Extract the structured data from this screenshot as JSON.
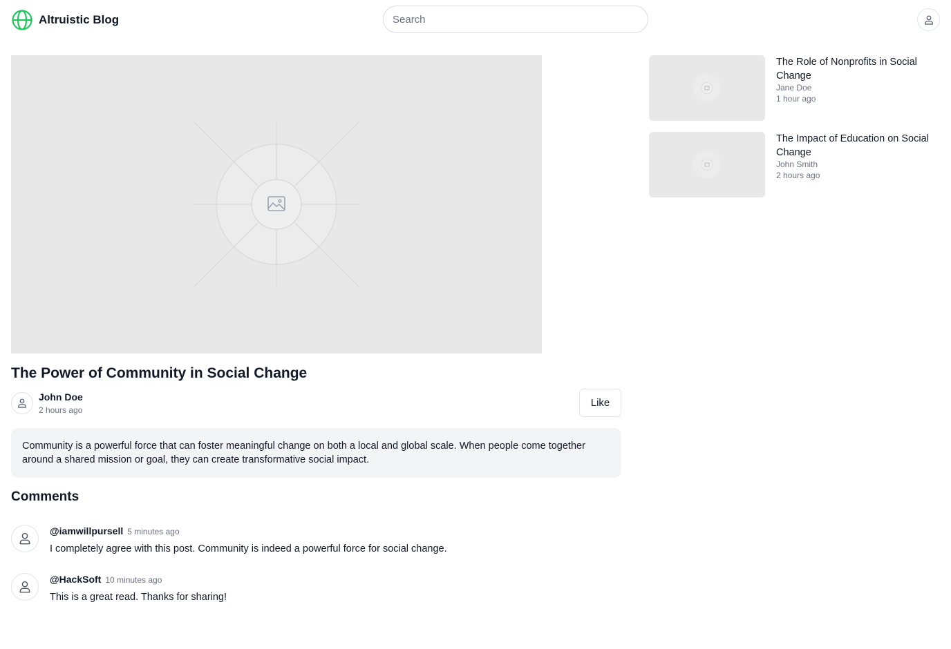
{
  "app": {
    "title": "Altruistic Blog",
    "brand_color": "#16a34a"
  },
  "header": {
    "search_placeholder": "Search",
    "search_icon_name": "globe-icon",
    "user_icon": "user-icon"
  },
  "post": {
    "image_icon": "image-placeholder-icon",
    "title": "The Power of Community in Social Change",
    "author": "John Doe",
    "time": "2 hours ago",
    "like_label": "Like",
    "body": "Community is a powerful force that can foster meaningful change on both a local and global scale. When people come together around a shared mission or goal, they can create transformative social impact."
  },
  "comments": {
    "title": "Comments",
    "items": [
      {
        "handle": "@iamwillpursell",
        "time": "5 minutes ago",
        "text": "I completely agree with this post. Community is indeed a powerful force for social change."
      },
      {
        "handle": "@HackSoft",
        "time": "10 minutes ago",
        "text": "This is a great read. Thanks for sharing!"
      }
    ]
  },
  "related": [
    {
      "title": "The Role of Nonprofits in Social Change",
      "author": "Jane Doe",
      "time": "1 hour ago"
    },
    {
      "title": "The Impact of Education on Social Change",
      "author": "John Smith",
      "time": "2 hours ago"
    }
  ]
}
